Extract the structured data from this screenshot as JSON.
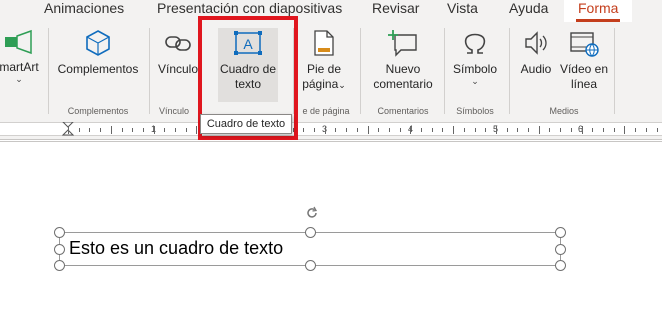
{
  "tabs": [
    {
      "label": "Animaciones"
    },
    {
      "label": "Presentación con diapositivas"
    },
    {
      "label": "Revisar"
    },
    {
      "label": "Vista"
    },
    {
      "label": "Ayuda"
    },
    {
      "label": "Forma",
      "active": true
    }
  ],
  "ribbon": {
    "smartart": {
      "label": "martArt"
    },
    "complementos": {
      "label": "Complementos",
      "group": "Complementos"
    },
    "vinculo": {
      "label": "Vínculo",
      "group": "Vínculo"
    },
    "cuadro_texto": {
      "line1": "Cuadro de",
      "line2": "texto"
    },
    "pie_pagina": {
      "line1": "Pie de",
      "line2": "página",
      "group": "e de página"
    },
    "nuevo_comentario": {
      "line1": "Nuevo",
      "line2": "comentario",
      "group": "Comentarios"
    },
    "simbolo": {
      "label": "Símbolo",
      "group": "Símbolos"
    },
    "audio": {
      "label": "Audio"
    },
    "video": {
      "line1": "Vídeo en",
      "line2": "línea"
    },
    "medios_group": "Medios",
    "cuadro_icon_letter": "A"
  },
  "tooltip": "Cuadro de texto",
  "ruler": {
    "numbers": [
      "1",
      "2",
      "3",
      "4",
      "5",
      "6"
    ]
  },
  "slide": {
    "textbox_text": "Esto es un cuadro de texto"
  },
  "colors": {
    "accent": "#c43e1c",
    "highlight": "#e0161e",
    "icon_blue": "#0f6cbd"
  }
}
